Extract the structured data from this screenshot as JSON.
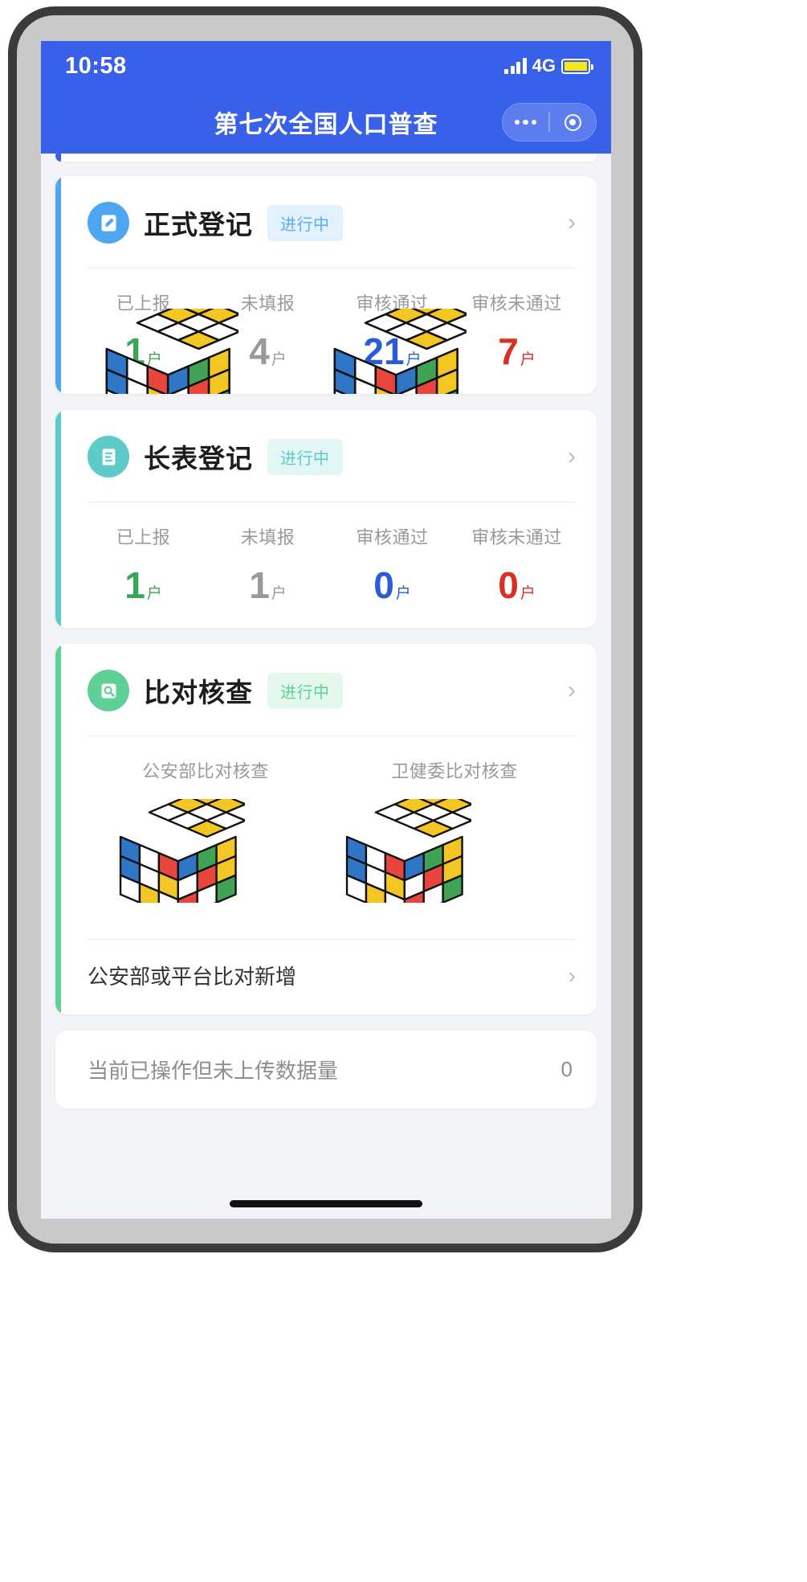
{
  "status_bar": {
    "time": "10:58",
    "network": "4G",
    "signal_icon": "signal-bars-icon",
    "battery_icon": "battery-icon"
  },
  "nav_bar": {
    "title": "第七次全国人口普查",
    "menu_icon": "more-dots-icon",
    "target_icon": "target-circle-icon"
  },
  "theme": {
    "primary_blue": "#3860e8",
    "card1_accent": "#4ea6f0",
    "card2_accent": "#5ecbcb",
    "card3_accent": "#5fd196",
    "green": "#3aa757",
    "gray": "#9a9a9a",
    "blue": "#2a5cd7",
    "red": "#d93025"
  },
  "cards": [
    {
      "id": "formal-registration",
      "icon": "edit-document-icon",
      "icon_bg": "#4ea6f0",
      "accent": "#4ea6f0",
      "title": "正式登记",
      "badge": "进行中",
      "badge_color": "#57aef2",
      "badge_bg": "#e3f1fd",
      "chevron": "›",
      "has_cubes": true,
      "stats": [
        {
          "label": "已上报",
          "value": "1",
          "unit": "户",
          "color": "#3aa757"
        },
        {
          "label": "未填报",
          "value": "4",
          "unit": "户",
          "color": "#9a9a9a"
        },
        {
          "label": "审核通过",
          "value": "21",
          "unit": "户",
          "color": "#2a5cd7"
        },
        {
          "label": "审核未通过",
          "value": "7",
          "unit": "户",
          "color": "#d93025"
        }
      ]
    },
    {
      "id": "long-form-registration",
      "icon": "list-document-icon",
      "icon_bg": "#5ecbcb",
      "accent": "#5ecbcb",
      "title": "长表登记",
      "badge": "进行中",
      "badge_color": "#5ecbcb",
      "badge_bg": "#e2f6f5",
      "chevron": "›",
      "has_cubes": false,
      "stats": [
        {
          "label": "已上报",
          "value": "1",
          "unit": "户",
          "color": "#3aa757"
        },
        {
          "label": "未填报",
          "value": "1",
          "unit": "户",
          "color": "#9a9a9a"
        },
        {
          "label": "审核通过",
          "value": "0",
          "unit": "户",
          "color": "#2a5cd7"
        },
        {
          "label": "审核未通过",
          "value": "0",
          "unit": "户",
          "color": "#d93025"
        }
      ]
    },
    {
      "id": "comparison-check",
      "icon": "search-square-icon",
      "icon_bg": "#5fd196",
      "accent": "#5fd196",
      "title": "比对核查",
      "badge": "进行中",
      "badge_color": "#5fd196",
      "badge_bg": "#e5f8ee",
      "chevron": "›",
      "has_cubes": true,
      "stats": [
        {
          "label": "公安部比对核查",
          "value": "",
          "unit": "",
          "color": "#9a9a9a"
        },
        {
          "label": "卫健委比对核查",
          "value": "",
          "unit": "",
          "color": "#9a9a9a"
        }
      ],
      "link_row": {
        "label": "公安部或平台比对新增",
        "chevron": "›"
      }
    }
  ],
  "bottom_card": {
    "label": "当前已操作但未上传数据量",
    "value": "0"
  }
}
